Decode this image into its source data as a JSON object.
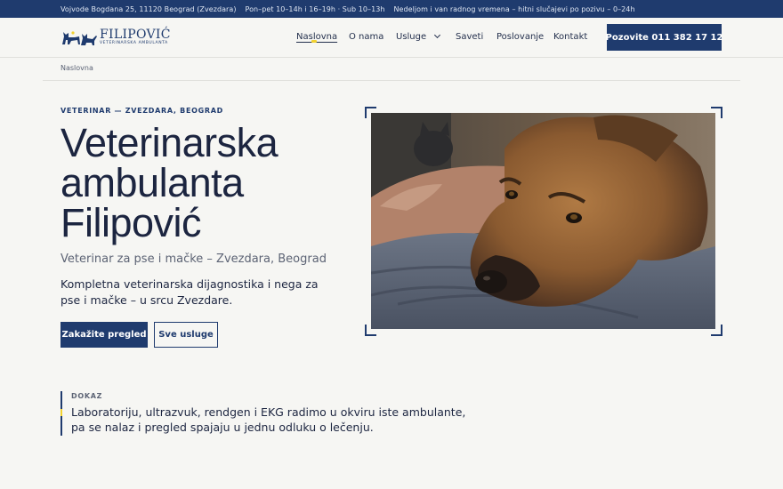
{
  "topbar": {
    "address": "Vojvode Bogdana 25, 11120 Beograd (Zvezdara)",
    "hours": "Pon–pet 10–14h i 16–19h · Sub 10–13h",
    "emergency": "Nedeljom i van radnog vremena – hitni slučajevi po pozivu – 0–24h"
  },
  "brand": {
    "name": "FILIPOVIĆ",
    "tagline": "VETERINARSKA AMBULANTA",
    "primary_color": "#1f3b6e",
    "accent_color": "#f2d230"
  },
  "nav": {
    "items": [
      {
        "label": "Naslovna",
        "active": true
      },
      {
        "label": "O nama"
      },
      {
        "label": "Usluge",
        "icon": "chevron-down-icon"
      },
      {
        "label": "Saveti"
      },
      {
        "label": "Poslovanje"
      },
      {
        "label": "Kontakt"
      }
    ],
    "cta_label": "Pozovite 011 382 17 12"
  },
  "breadcrumb": "Naslovna",
  "hero": {
    "eyebrow": "VETERINAR — ZVEZDARA, BEOGRAD",
    "title": "Veterinarska ambulanta Filipović",
    "subtitle": "Veterinar za pse i mačke – Zvezdara, Beograd",
    "description": "Kompletna veterinarska dijagnostika i nega za pse i mačke – u srcu Zvezdare.",
    "primary_button": "Zakažite pregled",
    "secondary_button": "Sve usluge"
  },
  "proof": {
    "label": "DOKAZ",
    "text": "Laboratoriju, ultrazvuk, rendgen i EKG radimo u okviru iste ambulante, pa se nalaz i pregled spajaju u jednu odluku o lečenju."
  }
}
